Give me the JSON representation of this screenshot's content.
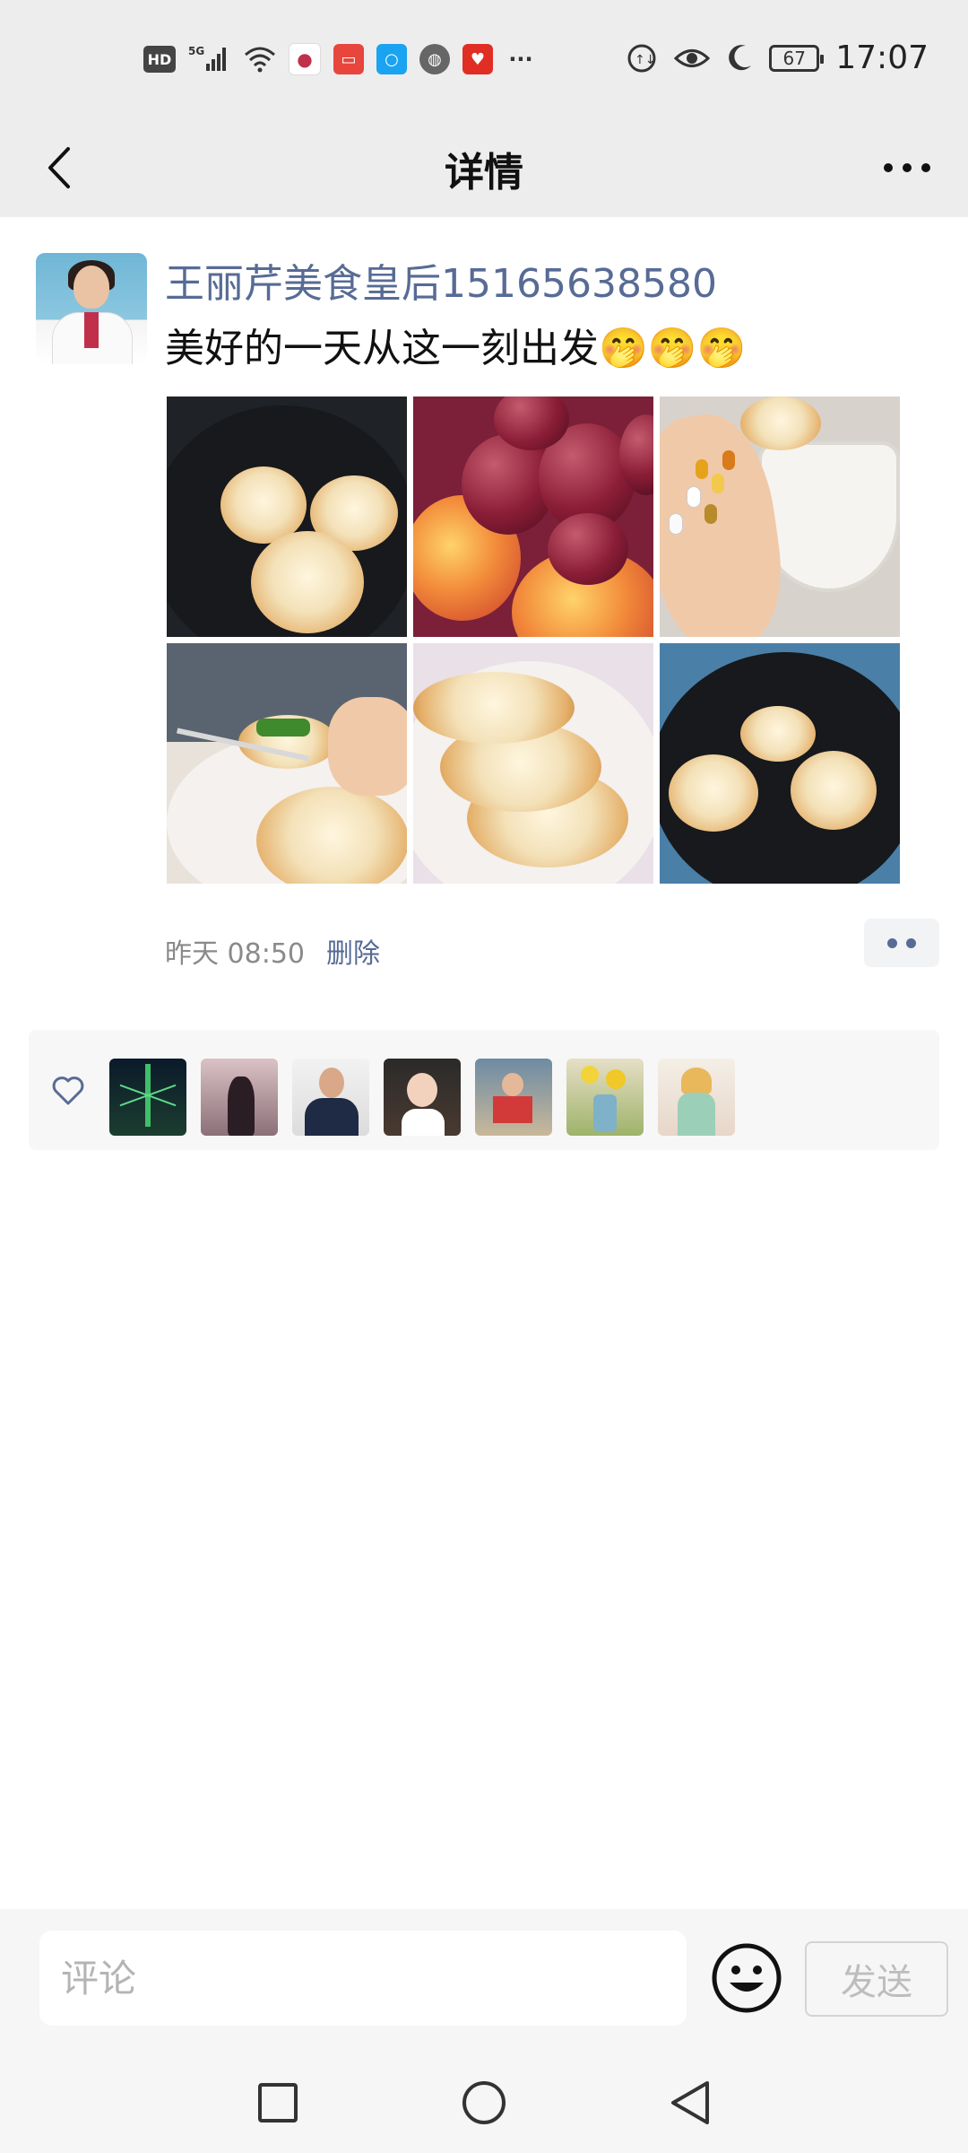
{
  "status_bar": {
    "time": "17:07",
    "battery": "67",
    "network_label": "5G",
    "hd_label": "HD",
    "more_label": "···"
  },
  "header": {
    "title": "详情"
  },
  "post": {
    "username": "王丽芹美食皇后15165638580",
    "content": "美好的一天从这一刻出发🤭🤭🤭",
    "time": "昨天 08:50",
    "delete_label": "删除"
  },
  "likes": {
    "count": 7
  },
  "composer": {
    "placeholder": "评论",
    "send_label": "发送"
  },
  "colors": {
    "link": "#576b95",
    "header_bg": "#ededed"
  }
}
